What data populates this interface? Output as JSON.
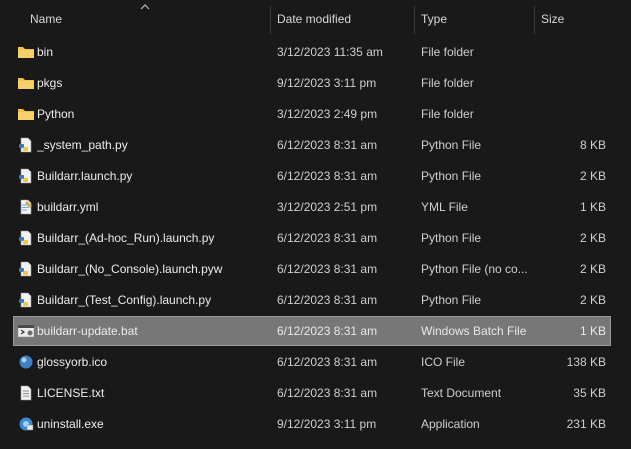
{
  "columns": {
    "name": "Name",
    "date": "Date modified",
    "type": "Type",
    "size": "Size"
  },
  "files": [
    {
      "name": "bin",
      "date": "3/12/2023 11:35 am",
      "type": "File folder",
      "size": "",
      "icon": "folder-icon"
    },
    {
      "name": "pkgs",
      "date": "9/12/2023 3:11 pm",
      "type": "File folder",
      "size": "",
      "icon": "folder-icon"
    },
    {
      "name": "Python",
      "date": "3/12/2023 2:49 pm",
      "type": "File folder",
      "size": "",
      "icon": "folder-icon"
    },
    {
      "name": "_system_path.py",
      "date": "6/12/2023 8:31 am",
      "type": "Python File",
      "size": "8 KB",
      "icon": "python-file-icon"
    },
    {
      "name": "Buildarr.launch.py",
      "date": "6/12/2023 8:31 am",
      "type": "Python File",
      "size": "2 KB",
      "icon": "python-file-icon"
    },
    {
      "name": "buildarr.yml",
      "date": "3/12/2023 2:51 pm",
      "type": "YML File",
      "size": "1 KB",
      "icon": "yml-file-icon"
    },
    {
      "name": "Buildarr_(Ad-hoc_Run).launch.py",
      "date": "6/12/2023 8:31 am",
      "type": "Python File",
      "size": "2 KB",
      "icon": "python-file-icon"
    },
    {
      "name": "Buildarr_(No_Console).launch.pyw",
      "date": "6/12/2023 8:31 am",
      "type": "Python File (no co...",
      "size": "2 KB",
      "icon": "python-file-icon"
    },
    {
      "name": "Buildarr_(Test_Config).launch.py",
      "date": "6/12/2023 8:31 am",
      "type": "Python File",
      "size": "2 KB",
      "icon": "python-file-icon"
    },
    {
      "name": "buildarr-update.bat",
      "date": "6/12/2023 8:31 am",
      "type": "Windows Batch File",
      "size": "1 KB",
      "icon": "batch-file-icon",
      "selected": true
    },
    {
      "name": "glossyorb.ico",
      "date": "6/12/2023 8:31 am",
      "type": "ICO File",
      "size": "138 KB",
      "icon": "ico-file-icon"
    },
    {
      "name": "LICENSE.txt",
      "date": "6/12/2023 8:31 am",
      "type": "Text Document",
      "size": "35 KB",
      "icon": "text-file-icon"
    },
    {
      "name": "uninstall.exe",
      "date": "9/12/2023 3:11 pm",
      "type": "Application",
      "size": "231 KB",
      "icon": "application-icon"
    }
  ],
  "colors": {
    "background": "#191919",
    "selection": "#777777",
    "folder": "#f0c24b"
  }
}
